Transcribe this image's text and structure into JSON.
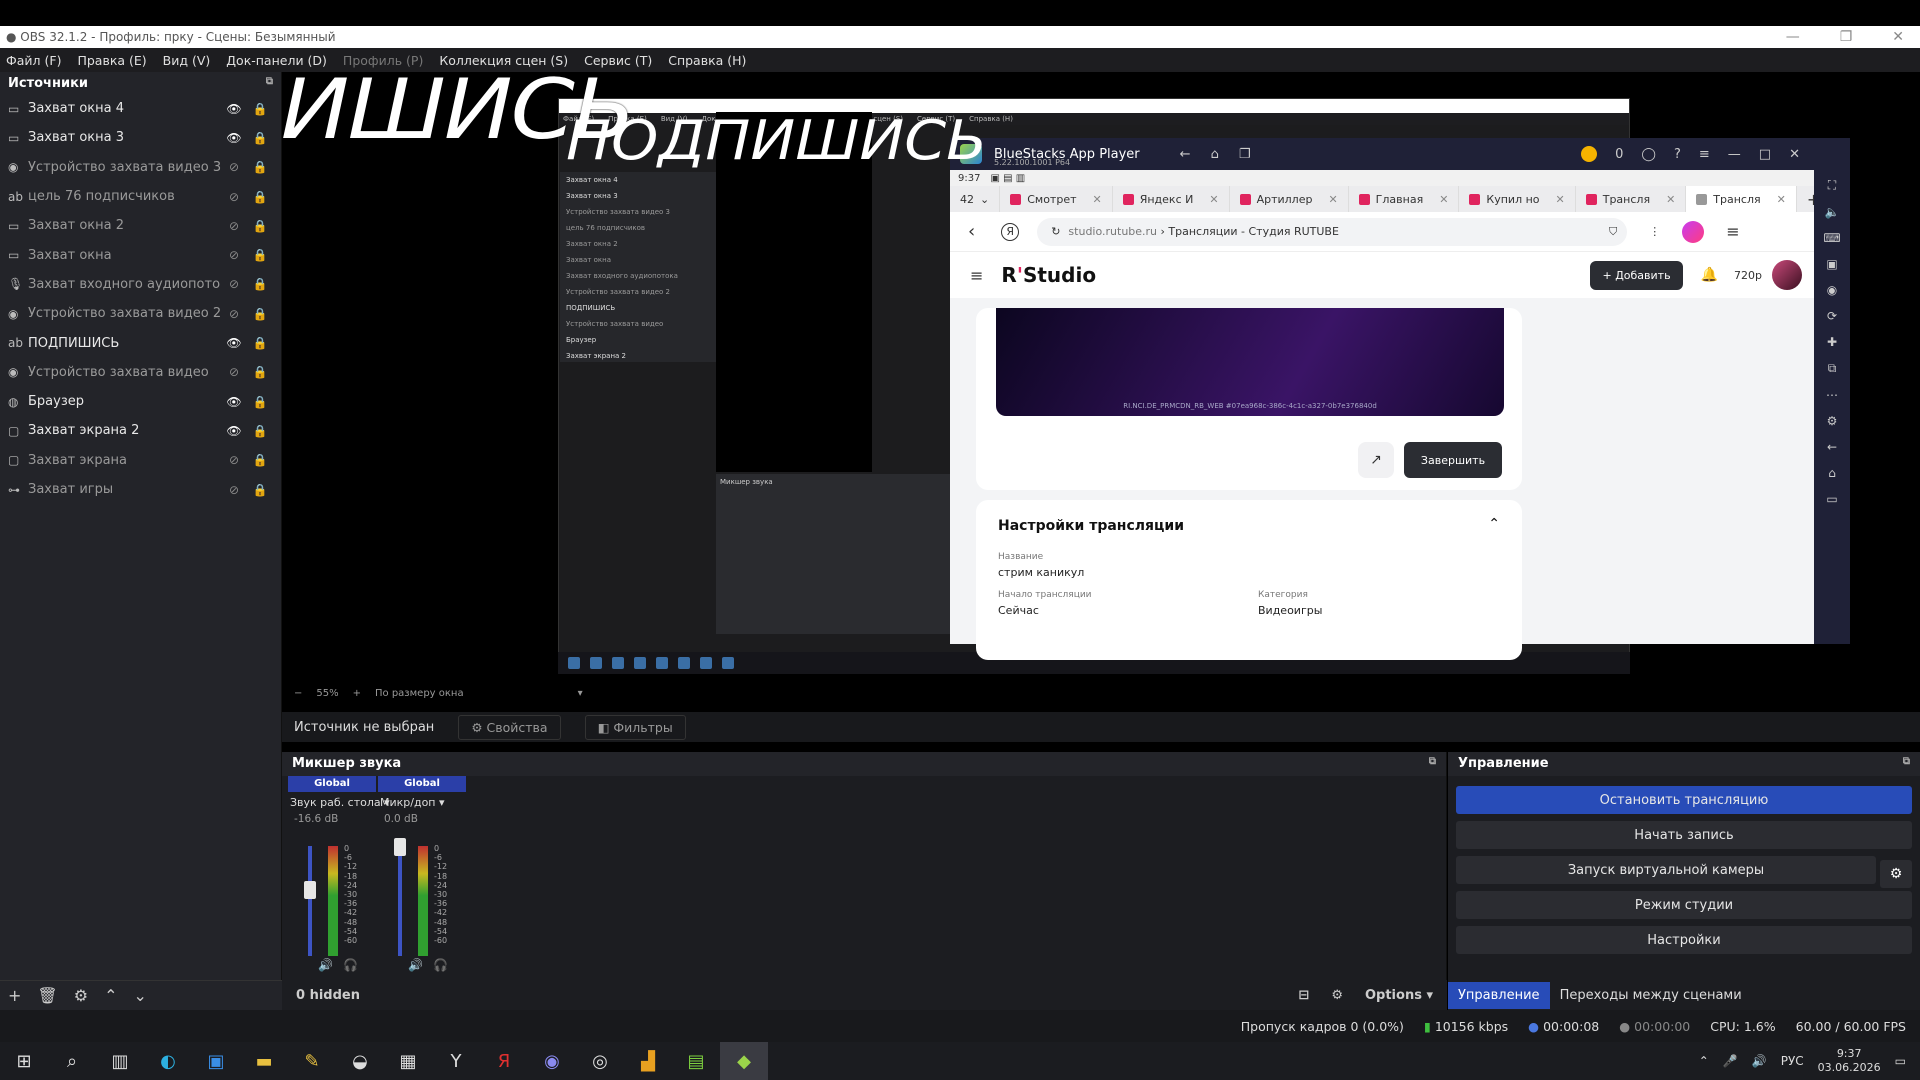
{
  "window": {
    "title": "OBS 32.1.2 - Профиль: прку - Сцены: Безымянный"
  },
  "menu": [
    "Файл (F)",
    "Правка (E)",
    "Вид (V)",
    "Док-панели (D)",
    "Профиль (P)",
    "Коллекция сцен (S)",
    "Сервис (T)",
    "Справка (H)"
  ],
  "sources": {
    "header": "Источники",
    "items": [
      {
        "label": "Захват окна 4",
        "icon": "window-capture-icon",
        "visible": true,
        "locked": false
      },
      {
        "label": "Захват окна 3",
        "icon": "window-capture-icon",
        "visible": true,
        "locked": false
      },
      {
        "label": "Устройство захвата видео 3",
        "icon": "camera-icon",
        "visible": false,
        "locked": true
      },
      {
        "label": "цель 76 подписчиков",
        "icon": "text-icon",
        "visible": false,
        "locked": false
      },
      {
        "label": "Захват окна 2",
        "icon": "window-capture-icon",
        "visible": false,
        "locked": false
      },
      {
        "label": "Захват окна",
        "icon": "window-capture-icon",
        "visible": false,
        "locked": false
      },
      {
        "label": "Захват входного аудиопотока",
        "icon": "microphone-icon",
        "visible": false,
        "locked": false
      },
      {
        "label": "Устройство захвата видео 2",
        "icon": "camera-icon",
        "visible": false,
        "locked": false
      },
      {
        "label": "ПОДПИШИСЬ",
        "icon": "text-icon",
        "visible": true,
        "locked": true
      },
      {
        "label": "Устройство захвата видео",
        "icon": "camera-icon",
        "visible": false,
        "locked": false
      },
      {
        "label": "Браузер",
        "icon": "globe-icon",
        "visible": true,
        "locked": false
      },
      {
        "label": "Захват экрана 2",
        "icon": "monitor-icon",
        "visible": true,
        "locked": false
      },
      {
        "label": "Захват экрана",
        "icon": "monitor-icon",
        "visible": false,
        "locked": false
      },
      {
        "label": "Захват игры",
        "icon": "gamepad-icon",
        "visible": false,
        "locked": false
      }
    ]
  },
  "preview": {
    "overlay_text": "ПОДПИШИСЬ",
    "zoom": "55%",
    "fit_label": "По размеру окна"
  },
  "bluestacks": {
    "title": "BlueStacks App Player",
    "version": "5.22.100.1001 P64",
    "coins": "0",
    "status_time": "9:37",
    "tab_count": "42",
    "tabs": [
      "Смотрет",
      "Яндекс И",
      "Артиллер",
      "Главная",
      "Купил но",
      "Трансля",
      "Трансля"
    ],
    "url_domain": "studio.rutube.ru",
    "url_path": "› Трансляции - Студия RUTUBE",
    "studio": {
      "logo_r": "R",
      "logo_rest": "Studio",
      "add_label": "Добавить",
      "quality": "720p",
      "video_caption": "RI.NCI.DE_PRMCDN_RB_WEB #07ea968c-386c-4c1c-a327-0b7e376840d",
      "end_label": "Завершить",
      "settings_title": "Настройки трансляции",
      "name_label": "Название",
      "name_value": "стрим каникул",
      "start_label": "Начало трансляции",
      "start_value": "Сейчас",
      "category_label": "Категория",
      "category_value": "Видеоигры"
    }
  },
  "properties": {
    "no_source": "Источник не выбран",
    "props_btn": "Свойства",
    "filters_btn": "Фильтры"
  },
  "mixer": {
    "header": "Микшер звука",
    "channels": [
      {
        "group": "Global",
        "name": "Звук раб. стола",
        "db": "-16.6 dB",
        "level": 0.6
      },
      {
        "group": "Global",
        "name": "Микр/доп",
        "db": "0.0 dB",
        "level": 1.0
      }
    ],
    "ticks": [
      "0",
      "-6",
      "-12",
      "-18",
      "-24",
      "-30",
      "-36",
      "-42",
      "-48",
      "-54",
      "-60"
    ],
    "hidden": "0 hidden",
    "options": "Options"
  },
  "controls": {
    "header": "Управление",
    "stop_stream": "Остановить трансляцию",
    "start_record": "Начать запись",
    "virtual_cam": "Запуск виртуальной камеры",
    "studio_mode": "Режим студии",
    "settings": "Настройки",
    "tab_controls": "Управление",
    "tab_transitions": "Переходы между сценами"
  },
  "status": {
    "dropped": "Пропуск кадров 0 (0.0%)",
    "bitrate": "10156 kbps",
    "stream_time": "00:00:08",
    "rec_time": "00:00:00",
    "cpu": "CPU: 1.6%",
    "fps": "60.00 / 60.00 FPS"
  },
  "taskbar": {
    "lang": "РУС",
    "time": "9:37",
    "date": "03.06.2026"
  }
}
